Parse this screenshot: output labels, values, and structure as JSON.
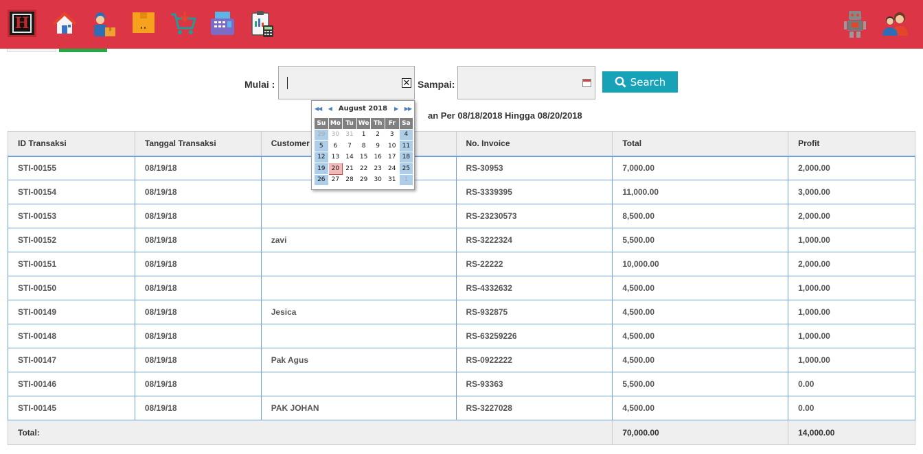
{
  "topbar": {
    "logo_letter": "H",
    "nav_icons": [
      "home-icon",
      "supplier-icon",
      "box-icon",
      "cart-icon",
      "cash-register-icon",
      "report-clipboard-icon"
    ],
    "right_icons": [
      "robot-icon",
      "users-icon"
    ],
    "color": "#dc3545"
  },
  "filter": {
    "mulai_label": "Mulai :",
    "mulai_value": "",
    "sampai_label": "Sampai:",
    "sampai_value": "",
    "search_label": "Search"
  },
  "period_text": "an Per 08/18/2018 Hingga 08/20/2018",
  "calendar": {
    "month_label": "August 2018",
    "weekdays": [
      "Su",
      "Mo",
      "Tu",
      "We",
      "Th",
      "Fr",
      "Sa"
    ],
    "weeks": [
      [
        "29",
        "30",
        "31",
        "1",
        "2",
        "3",
        "4"
      ],
      [
        "5",
        "6",
        "7",
        "8",
        "9",
        "10",
        "11"
      ],
      [
        "12",
        "13",
        "14",
        "15",
        "16",
        "17",
        "18"
      ],
      [
        "19",
        "20",
        "21",
        "22",
        "23",
        "24",
        "25"
      ],
      [
        "26",
        "27",
        "28",
        "29",
        "30",
        "31",
        "1"
      ]
    ],
    "selected_day": "20"
  },
  "table": {
    "headers": [
      "ID Transaksi",
      "Tanggal Transaksi",
      "Customer",
      "",
      "No. Invoice",
      "Total",
      "Profit"
    ],
    "rows": [
      [
        "STI-00155",
        "08/19/18",
        "",
        "RS-30953",
        "7,000.00",
        "2,000.00"
      ],
      [
        "STI-00154",
        "08/19/18",
        "",
        "RS-3339395",
        "11,000.00",
        "3,000.00"
      ],
      [
        "STI-00153",
        "08/19/18",
        "",
        "RS-23230573",
        "8,500.00",
        "2,000.00"
      ],
      [
        "STI-00152",
        "08/19/18",
        "zavi",
        "RS-3222324",
        "5,500.00",
        "1,000.00"
      ],
      [
        "STI-00151",
        "08/19/18",
        "",
        "RS-22222",
        "10,000.00",
        "2,000.00"
      ],
      [
        "STI-00150",
        "08/19/18",
        "",
        "RS-4332632",
        "4,500.00",
        "1,000.00"
      ],
      [
        "STI-00149",
        "08/19/18",
        "Jesica",
        "RS-932875",
        "4,500.00",
        "1,000.00"
      ],
      [
        "STI-00148",
        "08/19/18",
        "",
        "RS-63259226",
        "4,500.00",
        "1,000.00"
      ],
      [
        "STI-00147",
        "08/19/18",
        "Pak Agus",
        "RS-0922222",
        "4,500.00",
        "1,000.00"
      ],
      [
        "STI-00146",
        "08/19/18",
        "",
        "RS-93363",
        "5,500.00",
        "0.00"
      ],
      [
        "STI-00145",
        "08/19/18",
        "PAK JOHAN",
        "RS-3227028",
        "4,500.00",
        "0.00"
      ]
    ],
    "footer": {
      "label": "Total:",
      "total": "70,000.00",
      "profit": "14,000.00"
    }
  }
}
